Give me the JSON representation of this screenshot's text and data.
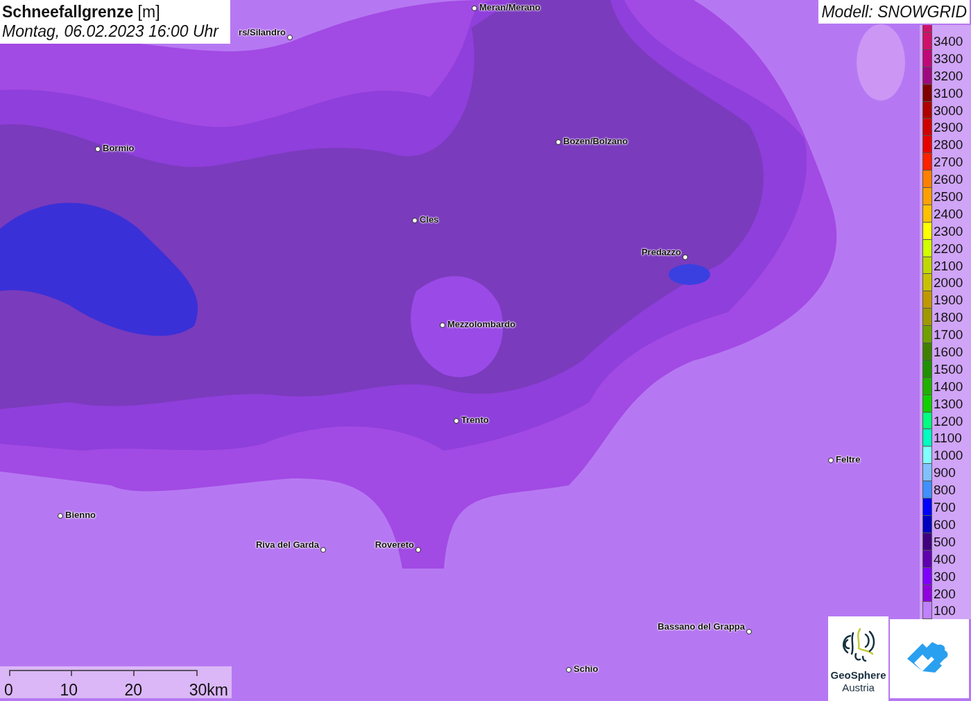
{
  "title": {
    "heading": "**Schneefallgrenze** [m]",
    "datetime": "Montag, 06.02.2023 16:00 Uhr"
  },
  "model_label": "Modell: SNOWGRID",
  "places": [
    {
      "name": "Meran/Merano"
    },
    {
      "name": "rs/Silandro"
    },
    {
      "name": "Bormio"
    },
    {
      "name": "Bozen/Bolzano"
    },
    {
      "name": "Cles"
    },
    {
      "name": "Predazzo"
    },
    {
      "name": "Mezzolombardo"
    },
    {
      "name": "Trento"
    },
    {
      "name": "Feltre"
    },
    {
      "name": "Bienno"
    },
    {
      "name": "Riva del Garda"
    },
    {
      "name": "Rovereto"
    },
    {
      "name": "Bassano del Grappa"
    },
    {
      "name": "Schio"
    }
  ],
  "legend": [
    {
      "label": "3400",
      "color": "#d0106a"
    },
    {
      "label": "3300",
      "color": "#c00878"
    },
    {
      "label": "3200",
      "color": "#a00880"
    },
    {
      "label": "3100",
      "color": "#800000"
    },
    {
      "label": "3000",
      "color": "#b00000"
    },
    {
      "label": "2900",
      "color": "#d00000"
    },
    {
      "label": "2800",
      "color": "#e80000"
    },
    {
      "label": "2700",
      "color": "#ff2000"
    },
    {
      "label": "2600",
      "color": "#ff8000"
    },
    {
      "label": "2500",
      "color": "#ffa000"
    },
    {
      "label": "2400",
      "color": "#ffc000"
    },
    {
      "label": "2300",
      "color": "#ffff00"
    },
    {
      "label": "2200",
      "color": "#d0ff00"
    },
    {
      "label": "2100",
      "color": "#c0d800"
    },
    {
      "label": "2000",
      "color": "#c8c000"
    },
    {
      "label": "1900",
      "color": "#c09800"
    },
    {
      "label": "1800",
      "color": "#a09800"
    },
    {
      "label": "1700",
      "color": "#70a000"
    },
    {
      "label": "1600",
      "color": "#408000"
    },
    {
      "label": "1500",
      "color": "#209000"
    },
    {
      "label": "1400",
      "color": "#20b000"
    },
    {
      "label": "1300",
      "color": "#10d000"
    },
    {
      "label": "1200",
      "color": "#00ff80"
    },
    {
      "label": "1100",
      "color": "#00ffc0"
    },
    {
      "label": "1000",
      "color": "#80ffff"
    },
    {
      "label": "900",
      "color": "#80c0ff"
    },
    {
      "label": "800",
      "color": "#4090ff"
    },
    {
      "label": "700",
      "color": "#0000ff"
    },
    {
      "label": "600",
      "color": "#0000c0"
    },
    {
      "label": "500",
      "color": "#400080"
    },
    {
      "label": "400",
      "color": "#6000b0"
    },
    {
      "label": "300",
      "color": "#8000ff"
    },
    {
      "label": "200",
      "color": "#9000e0"
    },
    {
      "label": "100",
      "color": "#c080ff"
    }
  ],
  "scale_bar": {
    "ticks": [
      "0",
      "10",
      "20",
      "30km"
    ]
  },
  "logo": {
    "line_1": "GeoSphere",
    "line_2": "Austria"
  }
}
